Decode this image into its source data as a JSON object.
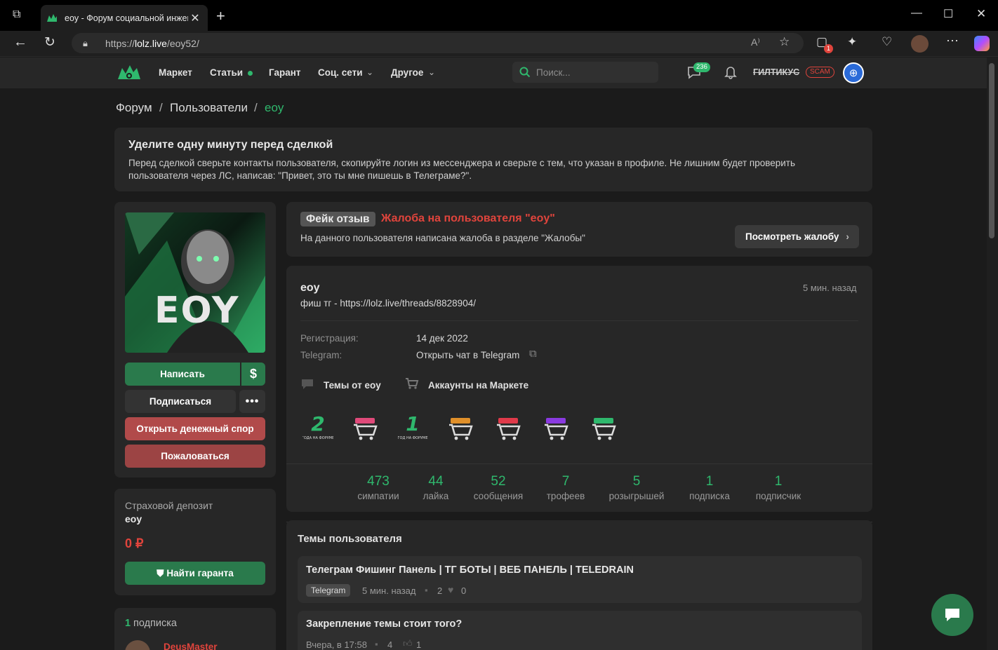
{
  "browser": {
    "tab_title": "eoy - Форум социальной инженерии",
    "url_prefix": "https://",
    "url_domain": "lolz.live",
    "url_path": "/eoy52/",
    "notifications_badge": "1"
  },
  "nav": {
    "items": [
      "Маркет",
      "Статьи",
      "Гарант",
      "Соц. сети",
      "Другое"
    ],
    "search_placeholder": "Поиск...",
    "messages_count": "236",
    "username": "ГИЛТИКУС",
    "username_badge": "SCAM"
  },
  "breadcrumb": {
    "forum": "Форум",
    "users": "Пользователи",
    "current": "eoy",
    "sep": "/"
  },
  "notice": {
    "title": "Уделите одну минуту перед сделкой",
    "text": "Перед сделкой сверьте контакты пользователя, скопируйте логин из мессенджера и сверьте с тем, что указан в профиле. Не лишним будет проверить пользователя через ЛС, написав: \"Привет, это ты мне пишешь в Телеграме?\"."
  },
  "profile_actions": {
    "avatar_text": "EOY",
    "write": "Написать",
    "dollar": "$",
    "subscribe": "Подписаться",
    "dispute": "Открыть денежный спор",
    "report": "Пожаловаться"
  },
  "deposit": {
    "title": "Страховой депозит",
    "user": "eoy",
    "amount": "0 ₽",
    "find_guarantor": "Найти гаранта"
  },
  "followers": {
    "count": "1",
    "label": "подписка",
    "first_user": "DeusMaster"
  },
  "complaint": {
    "tag": "Фейк отзыв",
    "title": "Жалоба на пользователя \"eoy\"",
    "text": "На данного пользователя написана жалоба в разделе \"Жалобы\"",
    "button": "Посмотреть жалобу"
  },
  "profile": {
    "name": "eoy",
    "time": "5 мин. назад",
    "status": "фиш тг - https://lolz.live/threads/8828904/",
    "reg_label": "Регистрация:",
    "reg_value": "14 дек 2022",
    "tg_label": "Telegram:",
    "tg_value": "Открыть чат в Telegram",
    "topics_link": "Темы от eoy",
    "market_link": "Аккаунты на Маркете"
  },
  "trophies": [
    {
      "icon": "years-2-trophy-icon",
      "num": "2",
      "text": "ГОДА НА ФОРУМЕ",
      "color": "#2fb86d"
    },
    {
      "icon": "cart-pink-trophy-icon",
      "color": "#e04a7a"
    },
    {
      "icon": "years-1-trophy-icon",
      "num": "1",
      "text": "ГОД НА ФОРУМЕ",
      "color": "#2fb86d"
    },
    {
      "icon": "cart-orange-trophy-icon",
      "color": "#e0902a"
    },
    {
      "icon": "cart-red-trophy-icon",
      "color": "#e03a4a"
    },
    {
      "icon": "cart-purple-trophy-icon",
      "color": "#8a3ae0"
    },
    {
      "icon": "cart-green-trophy-icon",
      "color": "#2fb86d"
    }
  ],
  "stats": [
    {
      "value": "473",
      "label": "симпатии"
    },
    {
      "value": "44",
      "label": "лайка"
    },
    {
      "value": "52",
      "label": "сообщения"
    },
    {
      "value": "7",
      "label": "трофеев"
    },
    {
      "value": "5",
      "label": "розыгрышей"
    },
    {
      "value": "1",
      "label": "подписка"
    },
    {
      "value": "1",
      "label": "подписчик"
    }
  ],
  "threads": {
    "heading": "Темы пользователя",
    "items": [
      {
        "title": "Телеграм Фишинг Панель | ТГ БОТЫ | ВЕБ ПАНЕЛЬ | TELEDRAIN",
        "tag": "Telegram",
        "time": "5 мин. назад",
        "replies": "2",
        "likes": "0"
      },
      {
        "title": "Закрепление темы стоит того?",
        "tag": "",
        "time": "Вчера, в 17:58",
        "replies": "4",
        "likes": "1"
      }
    ]
  },
  "colors": {
    "accent": "#2fb86d",
    "danger": "#e0443c",
    "dispute": "#b14a4a",
    "report": "#9c4444"
  }
}
